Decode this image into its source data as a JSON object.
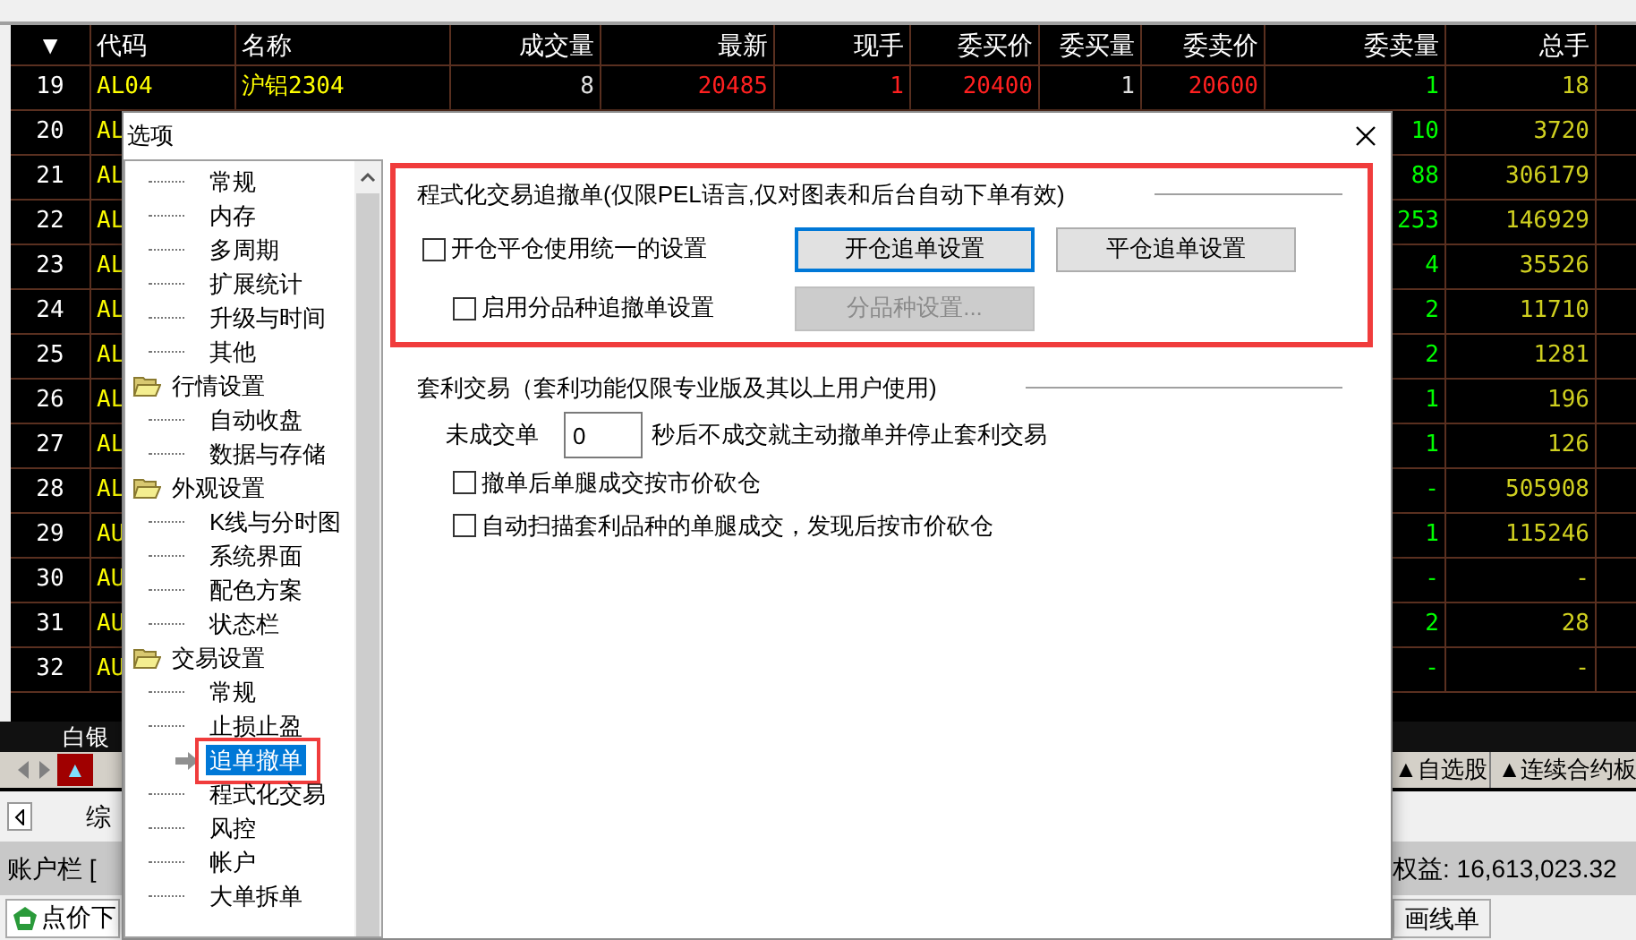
{
  "table": {
    "columns": [
      "▼",
      "代码",
      "名称",
      "成交量",
      "最新",
      "现手",
      "委买价",
      "委买量",
      "委卖价",
      "委卖量",
      "总手"
    ],
    "rows": [
      {
        "cells": [
          "19",
          "AL04",
          "沪铝2304",
          "8",
          "20485",
          "1",
          "20400",
          "1",
          "20600",
          "1",
          "18"
        ]
      },
      {
        "cells": [
          "20",
          "AL",
          null,
          null,
          null,
          null,
          null,
          null,
          null,
          "10",
          "3720"
        ]
      },
      {
        "cells": [
          "21",
          "AL",
          null,
          null,
          null,
          null,
          null,
          null,
          null,
          "88",
          "306179"
        ]
      },
      {
        "cells": [
          "22",
          "AL",
          null,
          null,
          null,
          null,
          null,
          null,
          null,
          "253",
          "146929"
        ]
      },
      {
        "cells": [
          "23",
          "AL",
          null,
          null,
          null,
          null,
          null,
          null,
          null,
          "4",
          "35526"
        ]
      },
      {
        "cells": [
          "24",
          "AL",
          null,
          null,
          null,
          null,
          null,
          null,
          null,
          "2",
          "11710"
        ]
      },
      {
        "cells": [
          "25",
          "AL",
          null,
          null,
          null,
          null,
          null,
          null,
          null,
          "2",
          "1281"
        ]
      },
      {
        "cells": [
          "26",
          "AL",
          null,
          null,
          null,
          null,
          null,
          null,
          null,
          "1",
          "196"
        ]
      },
      {
        "cells": [
          "27",
          "AL",
          null,
          null,
          null,
          null,
          null,
          null,
          null,
          "1",
          "126"
        ]
      },
      {
        "cells": [
          "28",
          "AL",
          null,
          null,
          null,
          null,
          null,
          null,
          null,
          "-",
          "505908"
        ]
      },
      {
        "cells": [
          "29",
          "AU",
          null,
          null,
          null,
          null,
          null,
          null,
          null,
          "1",
          "115246"
        ]
      },
      {
        "cells": [
          "30",
          "AU",
          null,
          null,
          null,
          null,
          null,
          null,
          null,
          "-",
          "-"
        ]
      },
      {
        "cells": [
          "31",
          "AU",
          null,
          null,
          null,
          null,
          null,
          null,
          null,
          "2",
          "28"
        ]
      },
      {
        "cells": [
          "32",
          "AU",
          null,
          null,
          null,
          null,
          null,
          null,
          null,
          "-",
          "-"
        ]
      }
    ]
  },
  "footer_label": "白银",
  "sheet_tabs_left": [
    {
      "label": "▲",
      "selected": true
    }
  ],
  "sheet_tabs_right": [
    {
      "label": "▲自选股",
      "selected": false
    },
    {
      "label": "▲连续合约板",
      "selected": false
    }
  ],
  "panel_tab": "综",
  "account_bar": {
    "title": "账户栏 [",
    "equity": "权益: 16,613,023.32"
  },
  "bottom_buttons": [
    "点价下",
    "画线单"
  ],
  "dialog": {
    "title": "选项",
    "tree": [
      {
        "children": [
          {
            "label": "常规",
            "selected": false
          },
          {
            "label": "内存",
            "selected": false
          },
          {
            "label": "多周期",
            "selected": false
          },
          {
            "label": "扩展统计",
            "selected": false
          },
          {
            "label": "升级与时间",
            "selected": false
          },
          {
            "label": "其他",
            "selected": false
          }
        ]
      },
      {
        "label": "行情设置",
        "children": [
          {
            "label": "自动收盘",
            "selected": false
          },
          {
            "label": "数据与存储",
            "selected": false
          }
        ]
      },
      {
        "label": "外观设置",
        "children": [
          {
            "label": "K线与分时图",
            "selected": false
          },
          {
            "label": "系统界面",
            "selected": false
          },
          {
            "label": "配色方案",
            "selected": false
          },
          {
            "label": "状态栏",
            "selected": false
          }
        ]
      },
      {
        "label": "交易设置",
        "children": [
          {
            "label": "常规",
            "selected": false
          },
          {
            "label": "止损止盈",
            "selected": false
          },
          {
            "label": "追单撤单",
            "selected": true
          },
          {
            "label": "程式化交易",
            "selected": false
          },
          {
            "label": "风控",
            "selected": false
          },
          {
            "label": "帐户",
            "selected": false
          },
          {
            "label": "大单拆单",
            "selected": false
          }
        ]
      }
    ],
    "sections": [
      {
        "title": "程式化交易追撤单(仅限PEL语言,仅对图表和后台自动下单有效)",
        "highlighted": true,
        "rows": [
          {
            "controls": [
              {
                "kind": "checkbox",
                "label": "开仓平仓使用统一的设置",
                "checked": false,
                "indented": false
              },
              {
                "kind": "button",
                "label": "开仓追单设置",
                "focused": true,
                "disabled": false
              },
              {
                "kind": "button",
                "label": "平仓追单设置",
                "focused": false,
                "disabled": false
              }
            ]
          },
          {
            "controls": [
              {
                "kind": "checkbox",
                "label": "启用分品种追撤单设置",
                "checked": false,
                "indented": true
              },
              {
                "kind": "button",
                "label": "分品种设置...",
                "focused": false,
                "disabled": true
              }
            ]
          }
        ]
      },
      {
        "title": "套利交易（套利功能仅限专业版及其以上用户使用)",
        "highlighted": false,
        "rows": [
          {
            "controls": [
              {
                "kind": "label",
                "label": "未成交单"
              },
              {
                "kind": "input",
                "value": "0"
              },
              {
                "kind": "label",
                "label": "秒后不成交就主动撤单并停止套利交易"
              }
            ]
          },
          {
            "controls": [
              {
                "kind": "checkbox",
                "label": "撤单后单腿成交按市价砍仓",
                "checked": false,
                "indented": true
              }
            ]
          },
          {
            "controls": [
              {
                "kind": "checkbox",
                "label": "自动扫描套利品种的单腿成交，发现后按市价砍仓",
                "checked": false,
                "indented": true
              }
            ]
          }
        ]
      }
    ]
  }
}
